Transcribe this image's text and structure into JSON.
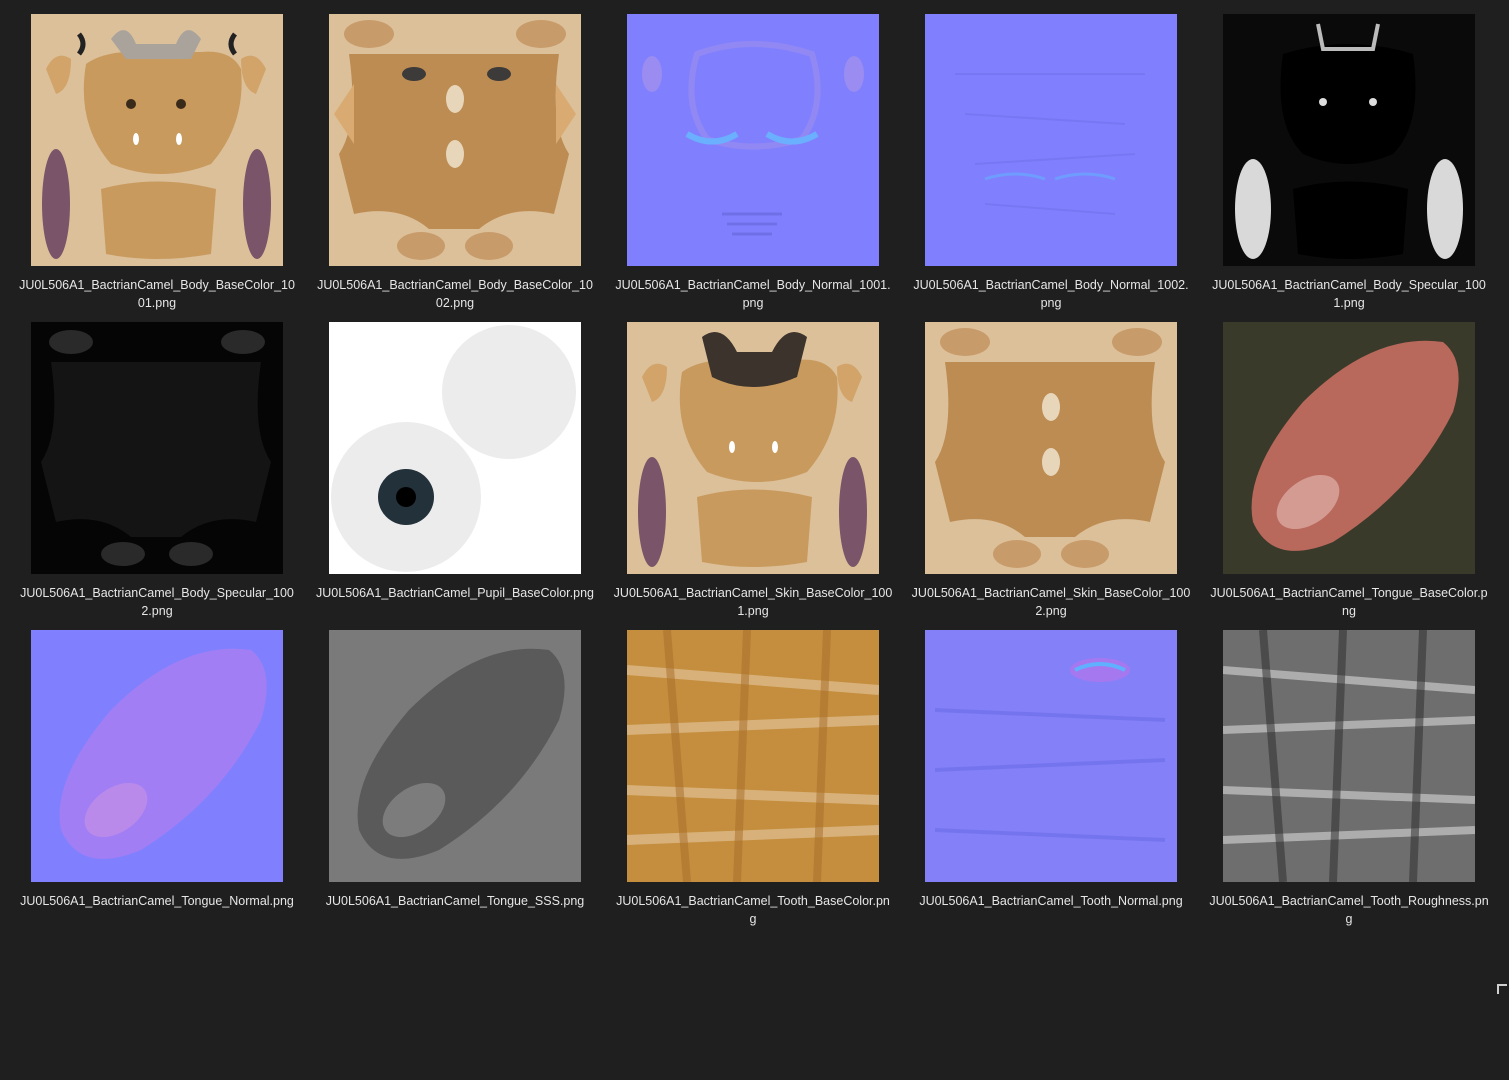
{
  "files": [
    {
      "name": "JU0L506A1_BactrianCamel_Body_BaseColor_1001.png",
      "icon": "body-basecolor-1001-thumbnail"
    },
    {
      "name": "JU0L506A1_BactrianCamel_Body_BaseColor_1002.png",
      "icon": "body-basecolor-1002-thumbnail"
    },
    {
      "name": "JU0L506A1_BactrianCamel_Body_Normal_1001.png",
      "icon": "body-normal-1001-thumbnail"
    },
    {
      "name": "JU0L506A1_BactrianCamel_Body_Normal_1002.png",
      "icon": "body-normal-1002-thumbnail"
    },
    {
      "name": "JU0L506A1_BactrianCamel_Body_Specular_1001.png",
      "icon": "body-specular-1001-thumbnail"
    },
    {
      "name": "JU0L506A1_BactrianCamel_Body_Specular_1002.png",
      "icon": "body-specular-1002-thumbnail"
    },
    {
      "name": "JU0L506A1_BactrianCamel_Pupil_BaseColor.png",
      "icon": "pupil-basecolor-thumbnail"
    },
    {
      "name": "JU0L506A1_BactrianCamel_Skin_BaseColor_1001.png",
      "icon": "skin-basecolor-1001-thumbnail"
    },
    {
      "name": "JU0L506A1_BactrianCamel_Skin_BaseColor_1002.png",
      "icon": "skin-basecolor-1002-thumbnail"
    },
    {
      "name": "JU0L506A1_BactrianCamel_Tongue_BaseColor.png",
      "icon": "tongue-basecolor-thumbnail"
    },
    {
      "name": "JU0L506A1_BactrianCamel_Tongue_Normal.png",
      "icon": "tongue-normal-thumbnail"
    },
    {
      "name": "JU0L506A1_BactrianCamel_Tongue_SSS.png",
      "icon": "tongue-sss-thumbnail"
    },
    {
      "name": "JU0L506A1_BactrianCamel_Tooth_BaseColor.png",
      "icon": "tooth-basecolor-thumbnail"
    },
    {
      "name": "JU0L506A1_BactrianCamel_Tooth_Normal.png",
      "icon": "tooth-normal-thumbnail"
    },
    {
      "name": "JU0L506A1_BactrianCamel_Tooth_Roughness.png",
      "icon": "tooth-roughness-thumbnail"
    }
  ],
  "colors": {
    "background": "#1f1f1f",
    "label": "#e6e6e6",
    "skin_bg": "#dcc09a",
    "normal_bg": "#8080fe",
    "specular_bg": "#0a0a0a"
  }
}
